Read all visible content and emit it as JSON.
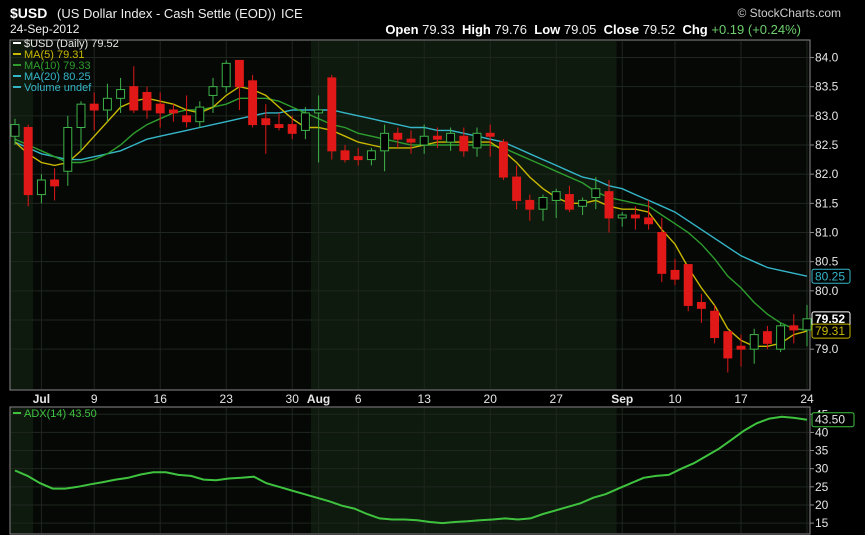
{
  "header": {
    "symbol": "$USD",
    "description": "(US Dollar Index - Cash Settle (EOD))",
    "exchange": "ICE",
    "date": "24-Sep-2012",
    "brand": "© StockCharts.com",
    "open_label": "Open",
    "open": "79.33",
    "high_label": "High",
    "high": "79.76",
    "low_label": "Low",
    "low": "79.05",
    "close_label": "Close",
    "close": "79.52",
    "chg_label": "Chg",
    "chg": "+0.19 (+0.24%)"
  },
  "colors": {
    "up": "#3fb34a",
    "down": "#e01818",
    "ma5": "#c9b800",
    "ma10": "#2e9d2e",
    "ma20": "#35b6c8",
    "adx": "#3fc33f",
    "panel_band": "#0e1a0e"
  },
  "chart_data": [
    {
      "type": "candlestick",
      "ylim": [
        78.3,
        84.3
      ],
      "yticks": [
        79.0,
        79.5,
        80.0,
        80.5,
        81.0,
        81.5,
        82.0,
        82.5,
        83.0,
        83.5,
        84.0
      ],
      "ytick_labels": [
        "79.0",
        "79.5",
        "80.0",
        "80.5",
        "81.0",
        "81.5",
        "82.0",
        "82.5",
        "83.0",
        "83.5",
        "84.0"
      ],
      "xtick_labels": [
        {
          "i": 2,
          "label": "Jul"
        },
        {
          "i": 6,
          "label": "9"
        },
        {
          "i": 11,
          "label": "16"
        },
        {
          "i": 16,
          "label": "23"
        },
        {
          "i": 21,
          "label": "30"
        },
        {
          "i": 23,
          "label": "Aug"
        },
        {
          "i": 26,
          "label": "6"
        },
        {
          "i": 31,
          "label": "13"
        },
        {
          "i": 36,
          "label": "20"
        },
        {
          "i": 41,
          "label": "27"
        },
        {
          "i": 46,
          "label": "Sep"
        },
        {
          "i": 50,
          "label": "10"
        },
        {
          "i": 55,
          "label": "17"
        },
        {
          "i": 60,
          "label": "24"
        }
      ],
      "band_start": 23,
      "band_end": 45,
      "legend": [
        {
          "label": "$USD (Daily) 79.52",
          "color": "#ffffff"
        },
        {
          "label": "MA(5) 79.31",
          "color": "#c9b800"
        },
        {
          "label": "MA(10) 79.33",
          "color": "#2e9d2e"
        },
        {
          "label": "MA(20) 80.25",
          "color": "#35b6c8"
        },
        {
          "label": "Volume undef",
          "color": "#35b6c8"
        }
      ],
      "right_labels": [
        {
          "value": 80.25,
          "label": "80.25",
          "color": "#35b6c8"
        },
        {
          "value": 79.52,
          "label": "79.52",
          "color": "#ffffff"
        },
        {
          "value": 79.31,
          "label": "79.31",
          "color": "#c9b800"
        }
      ],
      "ohlc": [
        [
          82.65,
          82.95,
          82.5,
          82.85
        ],
        [
          82.8,
          82.85,
          81.45,
          81.65
        ],
        [
          81.65,
          82.0,
          81.5,
          81.9
        ],
        [
          81.9,
          82.1,
          81.55,
          81.8
        ],
        [
          82.05,
          83.0,
          81.8,
          82.8
        ],
        [
          82.8,
          83.25,
          82.4,
          83.2
        ],
        [
          83.2,
          83.4,
          82.75,
          83.1
        ],
        [
          83.1,
          83.55,
          82.9,
          83.3
        ],
        [
          83.3,
          83.65,
          83.05,
          83.45
        ],
        [
          83.5,
          83.85,
          83.05,
          83.1
        ],
        [
          83.4,
          83.5,
          82.95,
          83.1
        ],
        [
          83.2,
          83.4,
          82.8,
          83.05
        ],
        [
          83.1,
          83.2,
          82.9,
          83.05
        ],
        [
          83.0,
          83.35,
          82.8,
          82.9
        ],
        [
          82.9,
          83.25,
          82.8,
          83.15
        ],
        [
          83.35,
          83.65,
          83.05,
          83.5
        ],
        [
          83.5,
          83.95,
          83.4,
          83.9
        ],
        [
          83.95,
          83.95,
          83.1,
          83.5
        ],
        [
          83.6,
          83.7,
          82.8,
          82.85
        ],
        [
          82.95,
          83.2,
          82.35,
          82.85
        ],
        [
          82.85,
          83.05,
          82.75,
          82.8
        ],
        [
          82.85,
          83.0,
          82.6,
          82.7
        ],
        [
          82.75,
          83.15,
          82.6,
          83.05
        ],
        [
          83.05,
          83.35,
          82.2,
          83.1
        ],
        [
          83.65,
          83.7,
          82.25,
          82.4
        ],
        [
          82.4,
          82.5,
          82.2,
          82.25
        ],
        [
          82.3,
          82.45,
          82.15,
          82.25
        ],
        [
          82.25,
          82.45,
          82.15,
          82.4
        ],
        [
          82.4,
          82.85,
          82.05,
          82.7
        ],
        [
          82.7,
          82.8,
          82.45,
          82.6
        ],
        [
          82.6,
          82.75,
          82.35,
          82.55
        ],
        [
          82.5,
          82.85,
          82.35,
          82.65
        ],
        [
          82.65,
          82.8,
          82.45,
          82.6
        ],
        [
          82.55,
          82.8,
          82.4,
          82.7
        ],
        [
          82.65,
          82.8,
          82.3,
          82.4
        ],
        [
          82.45,
          82.8,
          82.3,
          82.7
        ],
        [
          82.7,
          82.85,
          82.3,
          82.65
        ],
        [
          82.55,
          82.6,
          81.9,
          81.95
        ],
        [
          81.95,
          82.15,
          81.4,
          81.55
        ],
        [
          81.55,
          81.65,
          81.2,
          81.4
        ],
        [
          81.4,
          81.65,
          81.2,
          81.6
        ],
        [
          81.55,
          81.75,
          81.25,
          81.7
        ],
        [
          81.65,
          81.8,
          81.35,
          81.4
        ],
        [
          81.45,
          81.6,
          81.3,
          81.55
        ],
        [
          81.6,
          81.95,
          81.4,
          81.75
        ],
        [
          81.7,
          81.9,
          81.0,
          81.25
        ],
        [
          81.25,
          81.35,
          81.1,
          81.3
        ],
        [
          81.3,
          81.45,
          81.05,
          81.25
        ],
        [
          81.25,
          81.55,
          81.05,
          81.15
        ],
        [
          81.0,
          81.25,
          80.15,
          80.3
        ],
        [
          80.35,
          80.55,
          80.1,
          80.2
        ],
        [
          80.45,
          80.45,
          79.65,
          79.75
        ],
        [
          79.8,
          79.95,
          79.45,
          79.7
        ],
        [
          79.65,
          79.75,
          79.1,
          79.2
        ],
        [
          79.3,
          79.3,
          78.6,
          78.85
        ],
        [
          79.05,
          79.25,
          78.7,
          79.0
        ],
        [
          79.0,
          79.35,
          78.75,
          79.25
        ],
        [
          79.3,
          79.4,
          79.0,
          79.1
        ],
        [
          79.0,
          79.45,
          78.95,
          79.4
        ],
        [
          79.4,
          79.6,
          79.1,
          79.33
        ],
        [
          79.33,
          79.76,
          79.05,
          79.52
        ]
      ],
      "ma5": [
        82.55,
        82.35,
        82.2,
        82.15,
        82.2,
        82.4,
        82.65,
        82.9,
        83.15,
        83.25,
        83.3,
        83.25,
        83.2,
        83.1,
        83.05,
        83.15,
        83.35,
        83.5,
        83.45,
        83.35,
        83.15,
        82.95,
        82.8,
        82.8,
        82.75,
        82.65,
        82.55,
        82.5,
        82.45,
        82.45,
        82.45,
        82.5,
        82.55,
        82.55,
        82.55,
        82.55,
        82.55,
        82.4,
        82.2,
        81.95,
        81.75,
        81.6,
        81.5,
        81.5,
        81.55,
        81.45,
        81.4,
        81.4,
        81.35,
        81.05,
        80.8,
        80.4,
        80.05,
        79.75,
        79.35,
        79.15,
        79.05,
        79.05,
        79.1,
        79.25,
        79.31
      ],
      "ma10": [
        82.6,
        82.5,
        82.4,
        82.3,
        82.2,
        82.2,
        82.25,
        82.35,
        82.5,
        82.7,
        82.85,
        82.95,
        83.05,
        83.1,
        83.1,
        83.15,
        83.2,
        83.3,
        83.3,
        83.3,
        83.25,
        83.15,
        83.05,
        82.95,
        82.85,
        82.8,
        82.7,
        82.65,
        82.6,
        82.55,
        82.5,
        82.5,
        82.5,
        82.5,
        82.5,
        82.5,
        82.5,
        82.45,
        82.35,
        82.25,
        82.15,
        82.05,
        81.95,
        81.85,
        81.7,
        81.6,
        81.55,
        81.5,
        81.45,
        81.3,
        81.15,
        81.0,
        80.8,
        80.55,
        80.25,
        80.05,
        79.8,
        79.6,
        79.45,
        79.35,
        79.33
      ],
      "ma20": [
        82.55,
        82.45,
        82.35,
        82.3,
        82.25,
        82.25,
        82.3,
        82.35,
        82.4,
        82.5,
        82.6,
        82.65,
        82.7,
        82.75,
        82.8,
        82.85,
        82.9,
        82.95,
        83.0,
        83.05,
        83.05,
        83.1,
        83.1,
        83.1,
        83.1,
        83.05,
        83.0,
        82.95,
        82.9,
        82.85,
        82.8,
        82.8,
        82.75,
        82.75,
        82.7,
        82.65,
        82.6,
        82.55,
        82.45,
        82.35,
        82.25,
        82.15,
        82.05,
        81.95,
        81.9,
        81.8,
        81.75,
        81.65,
        81.55,
        81.45,
        81.35,
        81.2,
        81.05,
        80.9,
        80.75,
        80.6,
        80.5,
        80.4,
        80.35,
        80.3,
        80.25
      ]
    },
    {
      "type": "line",
      "legend": {
        "label": "ADX(14) 43.50",
        "color": "#3fc33f"
      },
      "ylim": [
        12,
        47
      ],
      "yticks": [
        15,
        20,
        25,
        30,
        35,
        40,
        45
      ],
      "ytick_labels": [
        "15",
        "20",
        "25",
        "30",
        "35",
        "40",
        "45"
      ],
      "last_label": {
        "value": 43.5,
        "label": "43.50"
      },
      "values": [
        29.5,
        28.0,
        26.0,
        24.5,
        24.5,
        25.0,
        25.7,
        26.3,
        27.0,
        27.5,
        28.4,
        29.0,
        29.0,
        28.3,
        28.0,
        27.0,
        26.8,
        27.3,
        27.5,
        27.8,
        26.0,
        25.0,
        24.0,
        23.0,
        22.0,
        21.0,
        19.8,
        19.0,
        17.5,
        16.3,
        16.0,
        16.0,
        15.8,
        15.3,
        15.0,
        15.3,
        15.5,
        15.8,
        16.0,
        16.3,
        16.0,
        16.3,
        17.5,
        18.5,
        19.5,
        20.5,
        22.0,
        23.0,
        24.5,
        26.0,
        27.5,
        28.0,
        28.3,
        30.0,
        31.5,
        33.5,
        35.5,
        38.0,
        40.5,
        42.5,
        43.8,
        44.3,
        44.0,
        43.5
      ]
    }
  ]
}
